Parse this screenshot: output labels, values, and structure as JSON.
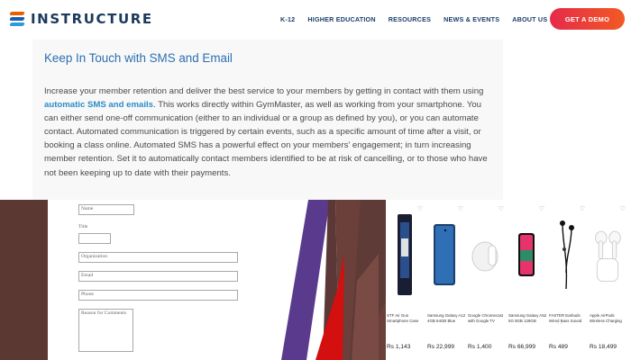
{
  "header": {
    "logo_text": "INSTRUCTURE",
    "nav": [
      "K-12",
      "HIGHER EDUCATION",
      "RESOURCES",
      "NEWS & EVENTS",
      "ABOUT US"
    ],
    "cta": "GET A DEMO"
  },
  "panel": {
    "title": "Keep In Touch with SMS and Email",
    "body_pre": "Increase your member retention and deliver the best service to your members by getting in contact with them using ",
    "body_link": "automatic SMS and emails",
    "body_post": ". This works directly within GymMaster, as well as working from your smartphone. You can either send one-off communication (either to an individual or a group as defined by you), or you can automate contact. Automated communication is triggered by certain events, such as a specific amount of time after a visit, or booking a class online. Automated SMS has a powerful effect on your members' engagement; in turn increasing member retention. Set it to automatically contact members identified to be at risk of cancelling, or to those who have not been keeping up to date with their payments."
  },
  "form": {
    "name": "Name",
    "title_label": "Title",
    "organization": "Organization",
    "email": "Email",
    "phone": "Phone",
    "comments": "Reason for Comments"
  },
  "products": [
    {
      "name": "STF Air Gun Smartphone Case 4GB 64GB Space",
      "price": "Rs 1,143"
    },
    {
      "name": "Samsung Galaxy A12 4GB 64GB Blue Variant",
      "price": "Rs 22,999"
    },
    {
      "name": "Google Chromecast with Google TV",
      "price": "Rs 1,400"
    },
    {
      "name": "Samsung Galaxy A52 5G 8GB 128GB Awesome",
      "price": "Rs 66,999"
    },
    {
      "name": "FASTER Earbuds Wired Bass Sound Headphones",
      "price": "Rs 489"
    },
    {
      "name": "Apple AirPods Wireless Charging Case",
      "price": "Rs 18,499"
    }
  ],
  "colors": {
    "brand": "#1b3a5c",
    "nav": "#1a3f6b",
    "cta_start": "#e62a4a",
    "cta_end": "#f15a24",
    "panel_title": "#2b6fb0",
    "link": "#2b8dc8"
  },
  "icons": {
    "logo": "instructure-logo-icon",
    "favorite": "heart-outline-icon"
  }
}
